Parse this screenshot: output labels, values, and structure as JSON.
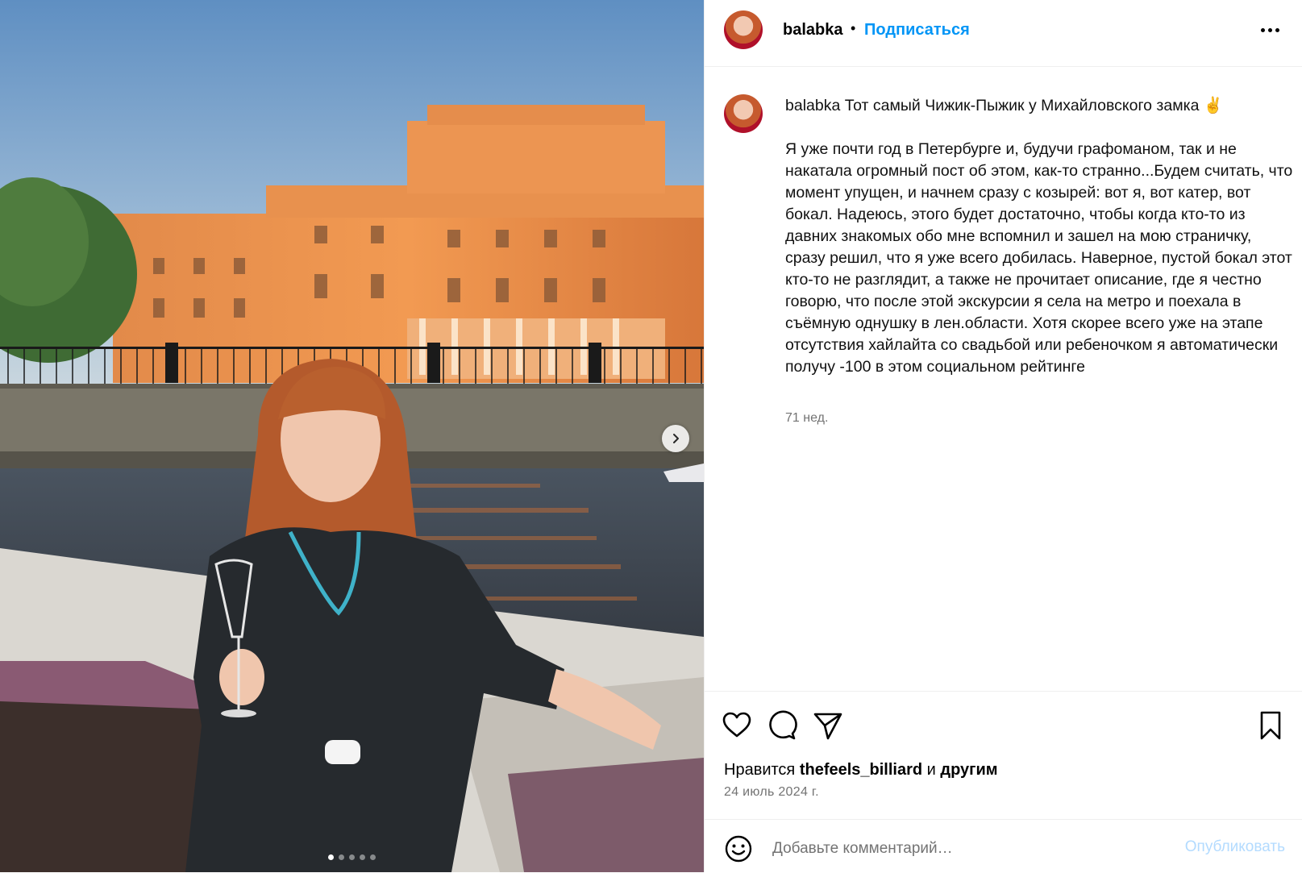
{
  "post": {
    "username": "balabka",
    "header_separator": "•",
    "follow_label": "Подписаться",
    "caption_title": "Тот самый Чижик-Пыжик у Михайловского замка ✌️",
    "caption_body": "Я уже почти год в Петербурге и, будучи графоманом, так и не накатала огромный пост об этом, как-то странно...Будем считать, что момент упущен, и начнем сразу с козырей: вот я, вот катер, вот бокал. Надеюсь, этого будет достаточно, чтобы когда кто-то из давних знакомых обо мне вспомнил и зашел на мою страничку, сразу решил, что я уже всего добилась. Наверное, пустой бокал этот кто-то не разглядит, а также не прочитает описание, где я честно говорю, что после этой экскурсии я села на метро и поехала в съёмную однушку в лен.области. Хотя скорее всего уже на этапе отсутствия хайлайта со свадьбой или ребеночком я автоматически получу -100 в этом социальном рейтинге",
    "caption_time": "71 нед.",
    "likes_prefix": "Нравится",
    "likes_user": "thefeels_billiard",
    "likes_and": "и",
    "likes_others": "другим",
    "date": "24 июль 2024 г."
  },
  "carousel": {
    "count": 5,
    "active_index": 0
  },
  "comment": {
    "placeholder": "Добавьте комментарий…",
    "post_label": "Опубликовать"
  },
  "colors": {
    "accent": "#0095f6",
    "post_disabled": "#b3dbff",
    "muted_text": "#737373"
  },
  "icons": [
    "heart-icon",
    "comment-icon",
    "share-icon",
    "bookmark-icon",
    "emoji-icon",
    "chevron-right-icon",
    "more-icon"
  ]
}
